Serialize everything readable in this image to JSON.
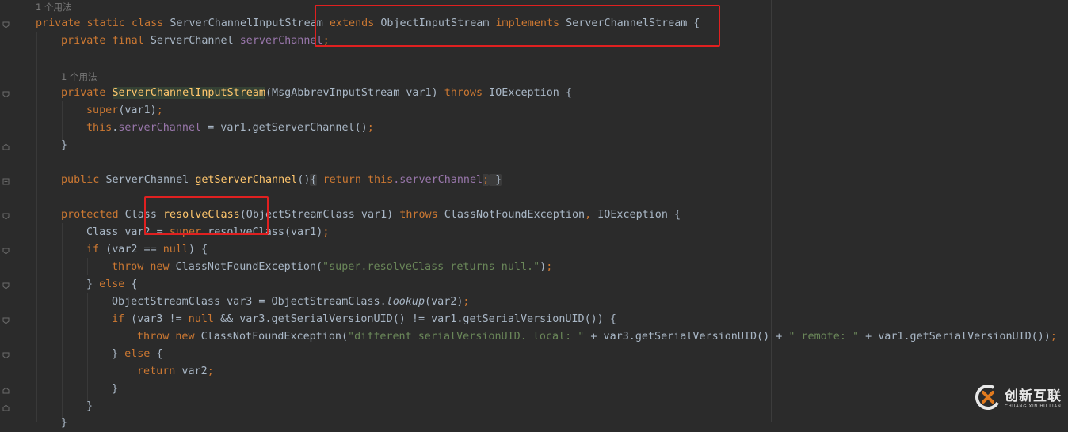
{
  "editor": {
    "usage_hint_1": "1 个用法",
    "usage_hint_2": "1 个用法",
    "lines": {
      "l1": {
        "kw_private": "private",
        "kw_static": "static",
        "kw_class": "class",
        "name": "ServerChannelInputStream",
        "kw_extends": "extends",
        "super": "ObjectInputStream",
        "kw_implements": "implements",
        "iface": "ServerChannelStream",
        "brace": "{"
      },
      "l2": {
        "kw": "private final",
        "type": "ServerChannel",
        "field": "serverChannel",
        "end": ";"
      },
      "l3": {
        "kw": "private",
        "ctor": "ServerChannelInputStream",
        "params": "(MsgAbbrevInputStream var1) ",
        "kw_throws": "throws",
        "rest": " IOException {"
      },
      "l4": {
        "kw_super": "super",
        "args": "(var1)",
        "end": ";"
      },
      "l5": {
        "kw_this": "this",
        "dot": ".",
        "field": "serverChannel",
        "rest": " = var1.getServerChannel()",
        "end": ";"
      },
      "l6": {
        "text": "}"
      },
      "l7": {
        "kw": "public",
        "type": "ServerChannel",
        "method": "getServerChannel",
        "parens": "()",
        "open": "{",
        "kw_return": "return",
        "kw_this": "this",
        "field": ".serverChannel",
        "semi": ";",
        "close": "}"
      },
      "l8": {
        "kw": "protected",
        "type": "Class",
        "method": "resolveClass",
        "params": "(ObjectStreamClass var1) ",
        "kw_throws": "throws",
        "ex1": " ClassNotFoundException",
        "comma": ",",
        "ex2": " IOException {"
      },
      "l9": {
        "pre": "Class var2 = ",
        "kw_super": "super",
        "rest": ".resolveClass(var1)",
        "end": ";"
      },
      "l10": {
        "kw_if": "if",
        "pre": " (var2 == ",
        "kw_null": "null",
        "post": ") {"
      },
      "l11": {
        "kw": "throw new",
        "type": " ClassNotFoundException(",
        "str": "\"super.resolveClass returns null.\"",
        "post": ")",
        "end": ";"
      },
      "l12": {
        "pre": "} ",
        "kw_else": "else",
        "post": " {"
      },
      "l13": {
        "pre": "ObjectStreamClass var3 = ObjectStreamClass.",
        "method": "lookup",
        "post": "(var2)",
        "end": ";"
      },
      "l14": {
        "kw_if": "if",
        "pre": " (var3 != ",
        "kw_null": "null",
        "post": " && var3.getSerialVersionUID() != var1.getSerialVersionUID()) {"
      },
      "l15": {
        "kw": "throw new",
        "pre": " ClassNotFoundException(",
        "str1": "\"different serialVersionUID. local: \"",
        "mid": " + var3.getSerialVersionUID() + ",
        "str2": "\" remote: \"",
        "post": " + var1.getSerialVersionUID())",
        "end": ";"
      },
      "l16": {
        "pre": "} ",
        "kw_else": "else",
        "post": " {"
      },
      "l17": {
        "kw_return": "return",
        "post": " var2",
        "end": ";"
      },
      "l18": {
        "text": "}"
      },
      "l19": {
        "text": "}"
      },
      "l20": {
        "text": "}"
      }
    }
  },
  "watermark": {
    "cn": "创新互联",
    "en": "CHUANG XIN HU LIAN",
    "logo_icon": "chuangxin-logo-icon"
  },
  "colors": {
    "background": "#2b2b2b",
    "keyword": "#cc7832",
    "method": "#ffc66d",
    "field": "#9876aa",
    "string": "#6a8759",
    "text": "#a9b7c6",
    "annotation_box": "#e02020"
  }
}
